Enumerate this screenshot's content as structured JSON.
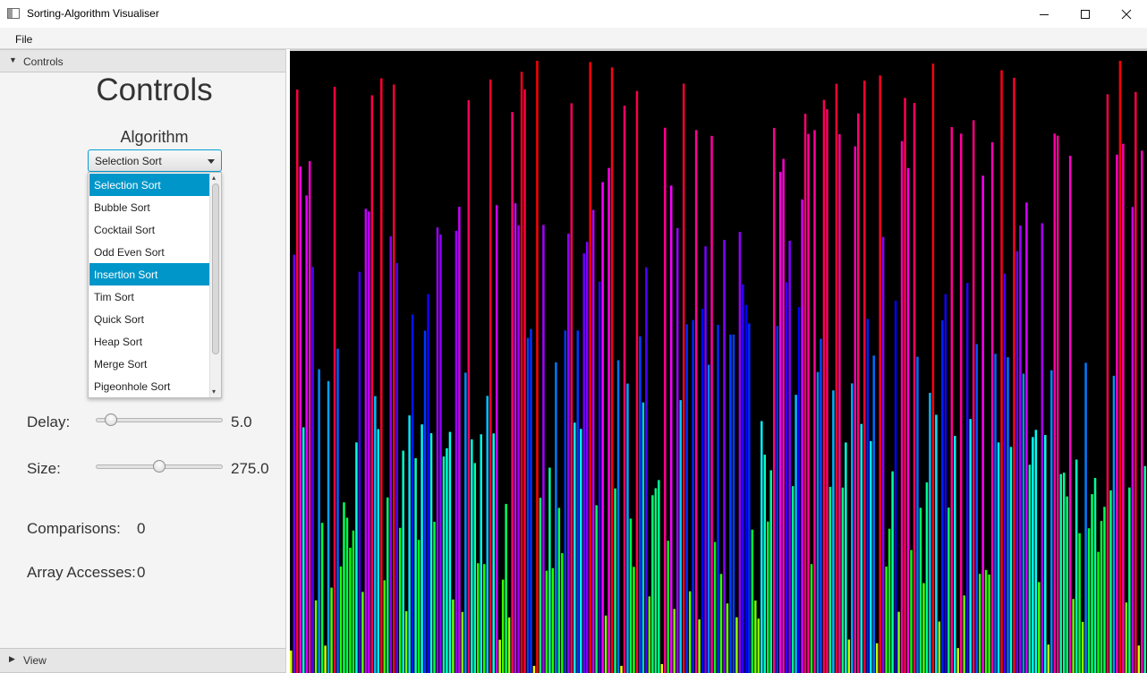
{
  "window": {
    "title": "Sorting-Algorithm Visualiser",
    "icons": {
      "app": "window-app-icon",
      "minimize": "minimize-icon",
      "maximize": "maximize-icon",
      "close": "close-icon"
    }
  },
  "menu": {
    "file": "File"
  },
  "panel": {
    "accordion_controls": "Controls",
    "accordion_view": "View",
    "heading": "Controls",
    "algorithm_label": "Algorithm",
    "algorithm_selected": "Selection Sort",
    "algorithm_options": [
      "Selection Sort",
      "Bubble Sort",
      "Cocktail Sort",
      "Odd Even Sort",
      "Insertion Sort",
      "Tim Sort",
      "Quick Sort",
      "Heap Sort",
      "Merge Sort",
      "Pigeonhole Sort"
    ],
    "highlighted_option": "Insertion Sort",
    "delay": {
      "label": "Delay:",
      "value": "5.0",
      "slider_fraction": 0.1
    },
    "size": {
      "label": "Size:",
      "value": "275.0",
      "slider_fraction": 0.5
    },
    "comparisons": {
      "label": "Comparisons:",
      "value": "0"
    },
    "array_accesses": {
      "label": "Array Accesses:",
      "value": "0"
    }
  },
  "visualiser": {
    "background": "#000000",
    "bar_count": 275,
    "color_scheme": "hue gradient by value: yellow (low) → green → cyan → blue → purple → red (high)"
  }
}
